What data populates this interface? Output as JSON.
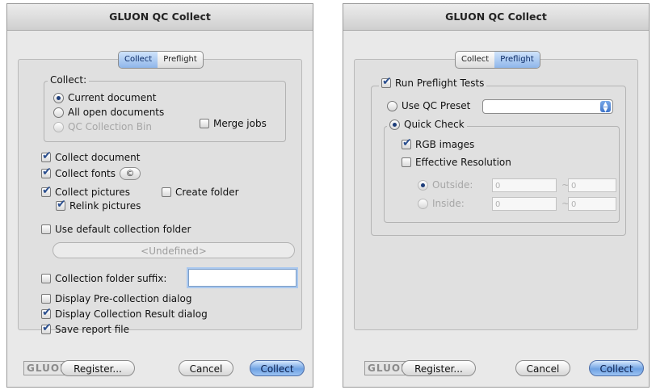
{
  "left": {
    "title": "GLUON QC Collect",
    "tabs": [
      "Collect",
      "Preflight"
    ],
    "collect_group": {
      "legend": "Collect:",
      "options": [
        "Current document",
        "All open documents",
        "QC Collection Bin"
      ],
      "merge_jobs": "Merge jobs"
    },
    "collect_document": "Collect document",
    "collect_fonts": "Collect fonts",
    "fonts_button_glyph": "©",
    "collect_pictures": "Collect pictures",
    "create_folder": "Create folder",
    "relink_pictures": "Relink pictures",
    "use_default_folder": "Use default collection folder",
    "undefined_label": "<Undefined>",
    "folder_suffix": "Collection folder suffix:",
    "display_pre": "Display Pre-collection dialog",
    "display_result": "Display Collection Result dialog",
    "save_report": "Save report file"
  },
  "right": {
    "title": "GLUON QC Collect",
    "tabs": [
      "Collect",
      "Preflight"
    ],
    "run_preflight": "Run Preflight Tests",
    "use_qc_preset": "Use QC Preset",
    "quick_check": "Quick Check",
    "rgb_images": "RGB images",
    "effective_resolution": "Effective Resolution",
    "outside_label": "Outside:",
    "inside_label": "Inside:",
    "outside_from": "0",
    "outside_to": "0",
    "inside_from": "0",
    "inside_to": "0",
    "tilde": "~"
  },
  "footer": {
    "logo": "GLUON",
    "register": "Register...",
    "cancel": "Cancel",
    "collect": "Collect"
  },
  "colors": {
    "accent": "#6fa2e3",
    "window_bg": "#e9e9e9"
  }
}
